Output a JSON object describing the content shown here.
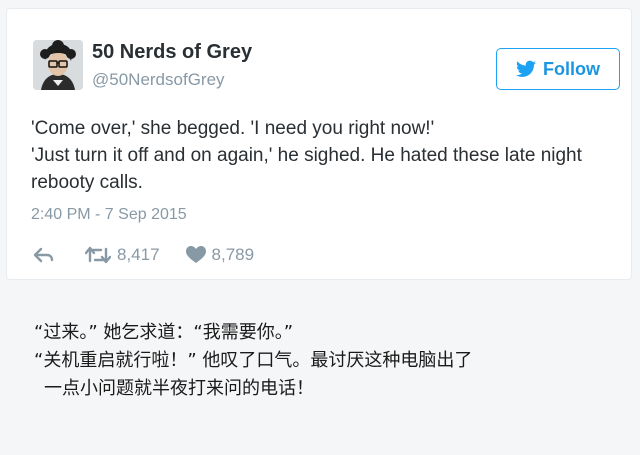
{
  "tweet": {
    "display_name": "50 Nerds of Grey",
    "handle": "@50NerdsofGrey",
    "avatar_icon": "profile-photo",
    "follow_label": "Follow",
    "follow_icon": "twitter-bird-icon",
    "lines": [
      "'Come over,' she begged. 'I need you right now!'",
      "'Just turn it off and on again,' he sighed. He hated these late night rebooty calls."
    ],
    "timestamp": "2:40 PM - 7 Sep 2015",
    "retweets": "8,417",
    "likes": "8,789",
    "accent_color": "#1da1f2",
    "muted_color": "#8899a6"
  },
  "caption": {
    "lines": [
      "“过来。” 她乞求道：“我需要你。”",
      "“关机重启就行啦！” 他叹了口气。最讨厌这种电脑出了",
      "一点小问题就半夜打来问的电话！"
    ]
  }
}
